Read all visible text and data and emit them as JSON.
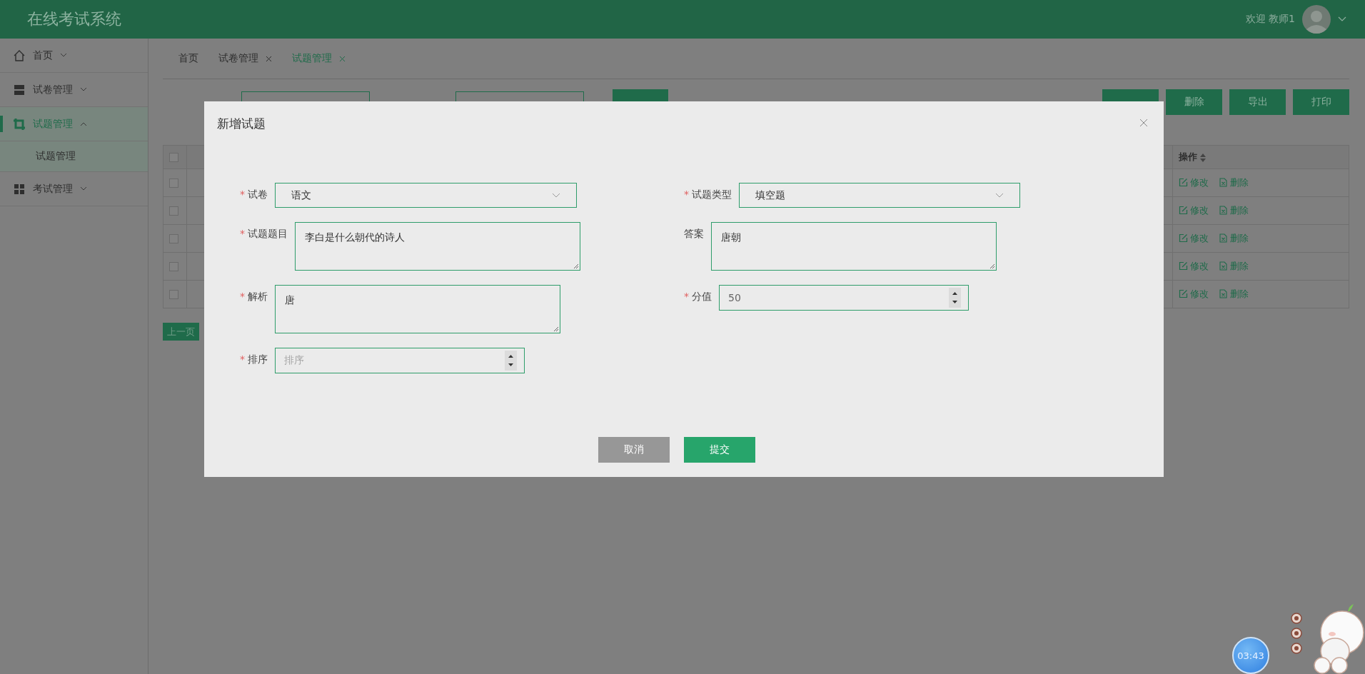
{
  "header": {
    "title": "在线考试系统",
    "welcome": "欢迎 教师1"
  },
  "sidebar": {
    "items": [
      {
        "label": "首页",
        "expanded": false,
        "selected": false
      },
      {
        "label": "试卷管理",
        "expanded": false,
        "selected": false
      },
      {
        "label": "试题管理",
        "expanded": true,
        "selected": true,
        "children": [
          {
            "label": "试题管理",
            "selected": false
          }
        ]
      },
      {
        "label": "考试管理",
        "expanded": false,
        "selected": false
      }
    ]
  },
  "tabs": [
    {
      "label": "首页",
      "closable": false,
      "selected": false
    },
    {
      "label": "试卷管理",
      "closable": true,
      "selected": false
    },
    {
      "label": "试题管理",
      "closable": true,
      "selected": true
    }
  ],
  "toolbar": {
    "buttons": [
      "删除",
      "导出",
      "打印"
    ]
  },
  "table": {
    "header_checked": false,
    "action_header": "操作",
    "rows": [
      {
        "checked": false,
        "actions": [
          "修改",
          "删除"
        ]
      },
      {
        "checked": false,
        "actions": [
          "修改",
          "删除"
        ]
      },
      {
        "checked": false,
        "actions": [
          "修改",
          "删除"
        ]
      },
      {
        "checked": false,
        "actions": [
          "修改",
          "删除"
        ]
      },
      {
        "checked": false,
        "actions": [
          "修改",
          "删除"
        ]
      }
    ]
  },
  "pagination": {
    "prev": "上一页"
  },
  "dialog": {
    "title": "新增试题",
    "left": [
      {
        "mark": "*",
        "label": "试卷",
        "kind": "select",
        "value": "语文"
      },
      {
        "mark": "*",
        "label": "试题题目",
        "kind": "textarea",
        "value": "李白是什么朝代的诗人"
      },
      {
        "mark": "*",
        "label": "解析",
        "kind": "textarea",
        "value": "唐"
      },
      {
        "mark": "*",
        "label": "排序",
        "kind": "number",
        "placeholder": "排序"
      }
    ],
    "right": [
      {
        "mark": "*",
        "label": "试题类型",
        "kind": "select",
        "value": "填空题"
      },
      {
        "label": "答案",
        "kind": "textarea",
        "value": "唐朝"
      },
      {
        "mark": "*",
        "label": "分值",
        "kind": "number",
        "value": "50"
      }
    ],
    "buttons": [
      {
        "label": "取消",
        "kind": "cancel"
      },
      {
        "label": "提交",
        "kind": "primary"
      }
    ]
  },
  "widget": {
    "timer": "03:43"
  }
}
